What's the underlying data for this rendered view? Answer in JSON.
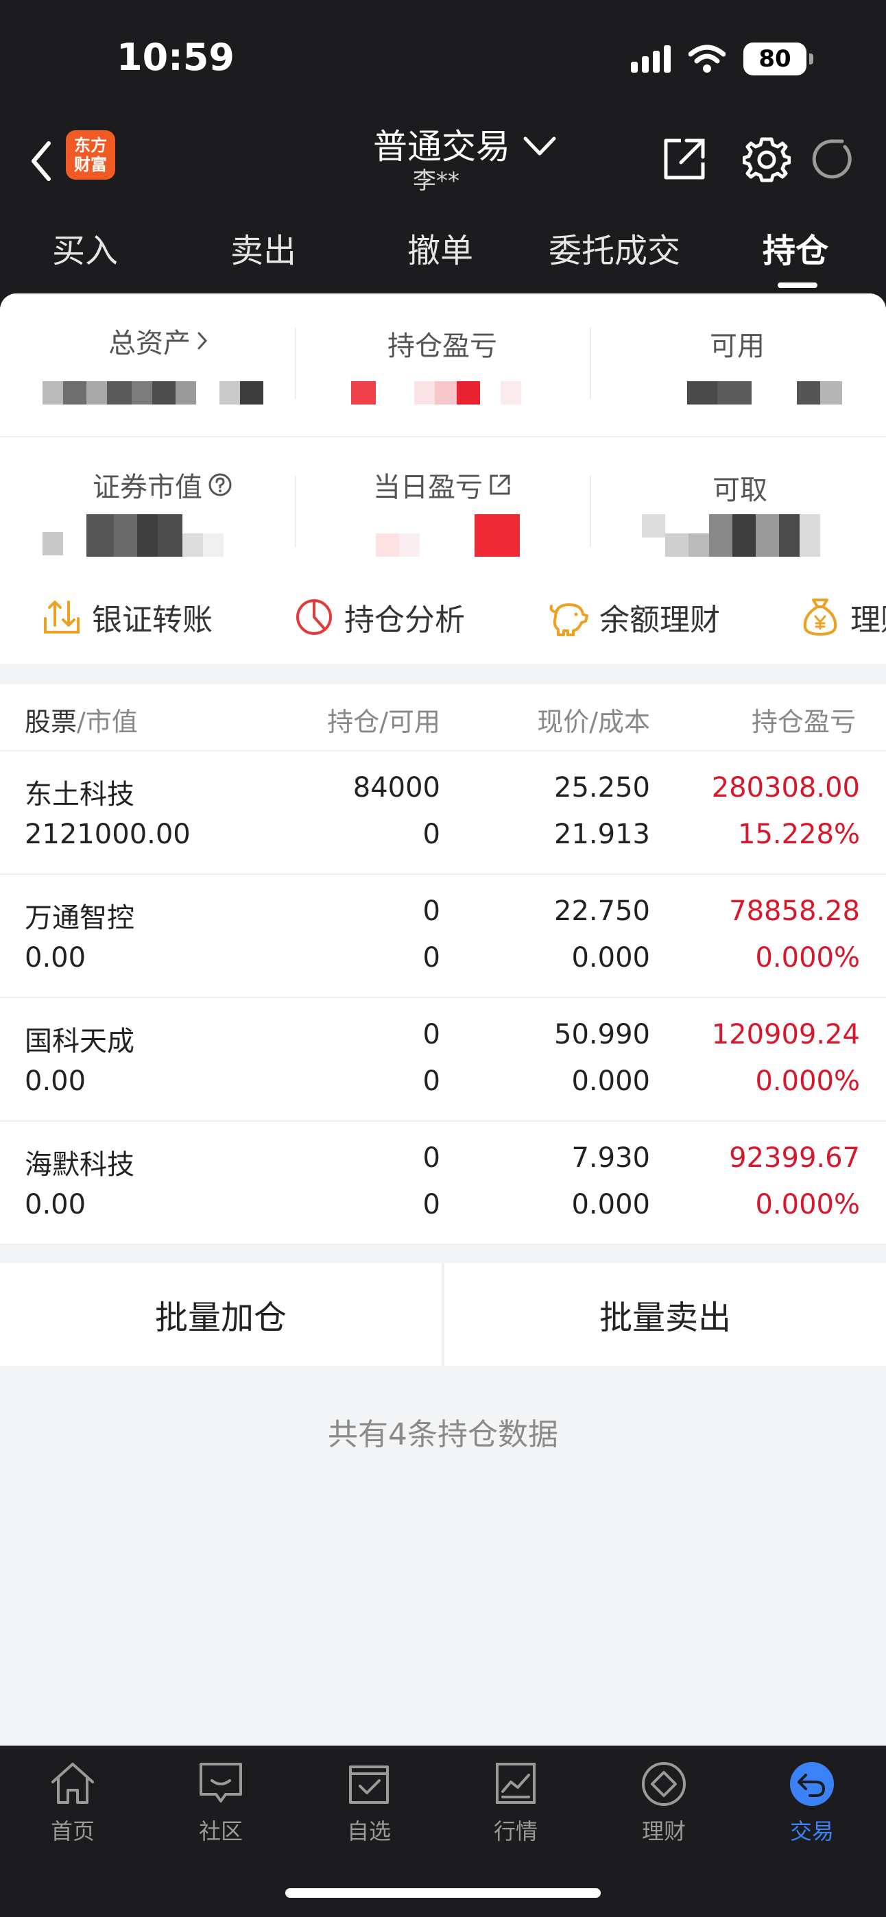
{
  "status_bar": {
    "time": "10:59",
    "battery": "80"
  },
  "header": {
    "logo_line1": "东方",
    "logo_line2": "财富",
    "title": "普通交易",
    "account": "李**"
  },
  "tabs": [
    {
      "label": "买入"
    },
    {
      "label": "卖出"
    },
    {
      "label": "撤单"
    },
    {
      "label": "委托成交"
    },
    {
      "label": "持仓",
      "active": true
    }
  ],
  "summary": {
    "total_assets": "总资产",
    "position_pnl": "持仓盈亏",
    "available": "可用",
    "market_value": "证券市值",
    "daily_pnl": "当日盈亏",
    "withdrawable": "可取"
  },
  "quick_actions": [
    {
      "label": "银证转账"
    },
    {
      "label": "持仓分析"
    },
    {
      "label": "余额理财"
    },
    {
      "label": "理财"
    }
  ],
  "table": {
    "header": {
      "stock": "股票",
      "market_value": "/市值",
      "position_available": "持仓/可用",
      "price_cost": "现价/成本",
      "pnl": "持仓盈亏"
    },
    "rows": [
      {
        "name": "东土科技",
        "value": "2121000.00",
        "position": "84000",
        "available": "0",
        "price": "25.250",
        "cost": "21.913",
        "pnl": "280308.00",
        "pnl_pct": "15.228%"
      },
      {
        "name": "万通智控",
        "value": "0.00",
        "position": "0",
        "available": "0",
        "price": "22.750",
        "cost": "0.000",
        "pnl": "78858.28",
        "pnl_pct": "0.000%"
      },
      {
        "name": "国科天成",
        "value": "0.00",
        "position": "0",
        "available": "0",
        "price": "50.990",
        "cost": "0.000",
        "pnl": "120909.24",
        "pnl_pct": "0.000%"
      },
      {
        "name": "海默科技",
        "value": "0.00",
        "position": "0",
        "available": "0",
        "price": "7.930",
        "cost": "0.000",
        "pnl": "92399.67",
        "pnl_pct": "0.000%"
      }
    ]
  },
  "batch": {
    "add": "批量加仓",
    "sell": "批量卖出"
  },
  "footer_note": "共有4条持仓数据",
  "bottom_nav": [
    {
      "label": "首页",
      "icon": "home-icon"
    },
    {
      "label": "社区",
      "icon": "chat-icon"
    },
    {
      "label": "自选",
      "icon": "checkbox-icon"
    },
    {
      "label": "行情",
      "icon": "chart-icon"
    },
    {
      "label": "理财",
      "icon": "diamond-icon"
    },
    {
      "label": "交易",
      "icon": "trade-icon",
      "active": true
    }
  ],
  "colors": {
    "up_red": "#d9172b",
    "accent_blue": "#3b82f6",
    "brand_orange": "#f15a22",
    "dark_bg": "#1c1c1e"
  }
}
